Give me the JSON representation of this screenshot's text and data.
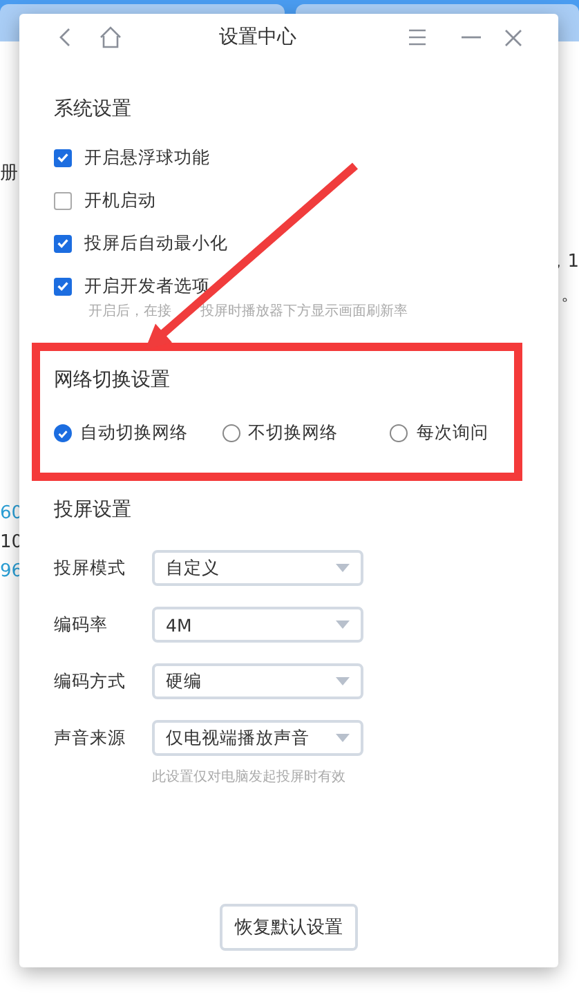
{
  "background": {
    "left_fragments": [
      "册",
      "60",
      "10",
      "96"
    ],
    "right_fragments": [
      "，1",
      "。"
    ]
  },
  "window": {
    "title": "设置中心"
  },
  "system": {
    "title": "系统设置",
    "options": [
      {
        "label": "开启悬浮球功能",
        "checked": true
      },
      {
        "label": "开机启动",
        "checked": false
      },
      {
        "label": "投屏后自动最小化",
        "checked": true
      },
      {
        "label": "开启开发者选项",
        "checked": true,
        "hint_parts": [
          "开启后，在接",
          "投屏时播放器下方显示画面刷新率"
        ]
      }
    ]
  },
  "network": {
    "title": "网络切换设置",
    "choices": [
      {
        "label": "自动切换网络",
        "selected": true
      },
      {
        "label": "不切换网络",
        "selected": false
      },
      {
        "label": "每次询问",
        "selected": false
      }
    ]
  },
  "cast": {
    "title": "投屏设置",
    "fields": [
      {
        "label": "投屏模式",
        "value": "自定义"
      },
      {
        "label": "编码率",
        "value": "4M"
      },
      {
        "label": "编码方式",
        "value": "硬编"
      },
      {
        "label": "声音来源",
        "value": "仅电视端播放声音",
        "hint": "此设置仅对电脑发起投屏时有效"
      }
    ]
  },
  "reset_button": "恢复默认设置"
}
